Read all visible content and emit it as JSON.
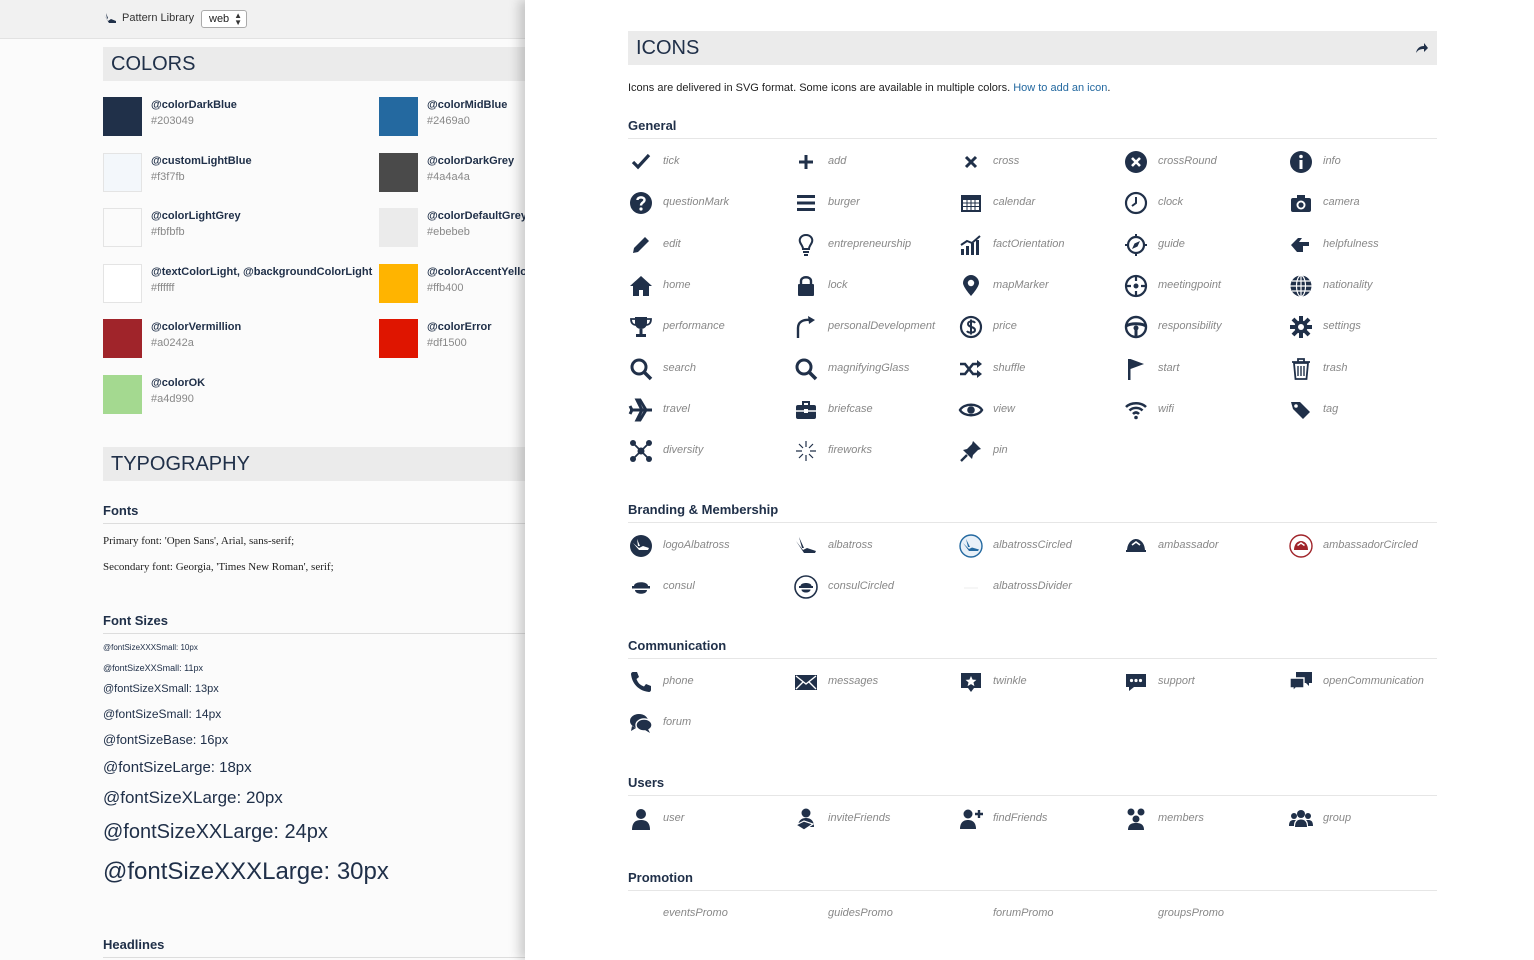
{
  "topbar": {
    "title": "Pattern Library",
    "select_value": "web"
  },
  "colors": {
    "heading": "COLORS",
    "items": [
      {
        "name": "@colorDarkBlue",
        "hex": "#203049"
      },
      {
        "name": "@colorMidBlue",
        "hex": "#2469a0"
      },
      {
        "name": "@customLightBlue",
        "hex": "#f3f7fb"
      },
      {
        "name": "@colorDarkGrey",
        "hex": "#4a4a4a"
      },
      {
        "name": "@colorLightGrey",
        "hex": "#fbfbfb"
      },
      {
        "name": "@colorDefaultGrey",
        "hex": "#ebebeb"
      },
      {
        "name": "@textColorLight, @backgroundColorLight",
        "hex": "#ffffff"
      },
      {
        "name": "@colorAccentYellow",
        "hex": "#ffb400"
      },
      {
        "name": "@colorVermillion",
        "hex": "#a0242a"
      },
      {
        "name": "@colorError",
        "hex": "#df1500"
      },
      {
        "name": "@colorOK",
        "hex": "#a4d990"
      }
    ]
  },
  "typography": {
    "heading": "TYPOGRAPHY",
    "fonts_title": "Fonts",
    "primary": "Primary font: 'Open Sans', Arial, sans-serif;",
    "secondary": "Secondary font: Georgia, 'Times New Roman', serif;",
    "sizes_title": "Font Sizes",
    "sizes": [
      "@fontSizeXXXSmall: 10px",
      "@fontSizeXXSmall: 11px",
      "@fontSizeXSmall: 13px",
      "@fontSizeSmall: 14px",
      "@fontSizeBase: 16px",
      "@fontSizeLarge: 18px",
      "@fontSizeXLarge: 20px",
      "@fontSizeXXLarge: 24px",
      "@fontSizeXXXLarge: 30px"
    ],
    "headlines_title": "Headlines"
  },
  "icons": {
    "heading": "ICONS",
    "intro_text": "Icons are delivered in SVG format. Some icons are available in multiple colors. ",
    "intro_link": "How to add an icon",
    "intro_end": ".",
    "sections": [
      {
        "title": "General",
        "items": [
          {
            "label": "tick",
            "icon": "tick-icon"
          },
          {
            "label": "add",
            "icon": "add-icon"
          },
          {
            "label": "cross",
            "icon": "cross-icon"
          },
          {
            "label": "crossRound",
            "icon": "cross-round-icon"
          },
          {
            "label": "info",
            "icon": "info-icon"
          },
          {
            "label": "questionMark",
            "icon": "question-mark-icon"
          },
          {
            "label": "burger",
            "icon": "burger-icon"
          },
          {
            "label": "calendar",
            "icon": "calendar-icon"
          },
          {
            "label": "clock",
            "icon": "clock-icon"
          },
          {
            "label": "camera",
            "icon": "camera-icon"
          },
          {
            "label": "edit",
            "icon": "edit-icon"
          },
          {
            "label": "entrepreneurship",
            "icon": "lightbulb-icon"
          },
          {
            "label": "factOrientation",
            "icon": "chart-icon"
          },
          {
            "label": "guide",
            "icon": "compass-icon"
          },
          {
            "label": "helpfulness",
            "icon": "hand-icon"
          },
          {
            "label": "home",
            "icon": "home-icon"
          },
          {
            "label": "lock",
            "icon": "lock-icon"
          },
          {
            "label": "mapMarker",
            "icon": "map-marker-icon"
          },
          {
            "label": "meetingpoint",
            "icon": "meetingpoint-icon"
          },
          {
            "label": "nationality",
            "icon": "globe-icon"
          },
          {
            "label": "performance",
            "icon": "trophy-icon"
          },
          {
            "label": "personalDevelopment",
            "icon": "growth-icon"
          },
          {
            "label": "price",
            "icon": "dollar-icon"
          },
          {
            "label": "responsibility",
            "icon": "steering-wheel-icon"
          },
          {
            "label": "settings",
            "icon": "gear-icon"
          },
          {
            "label": "search",
            "icon": "search-icon"
          },
          {
            "label": "magnifyingGlass",
            "icon": "magnifying-glass-icon"
          },
          {
            "label": "shuffle",
            "icon": "shuffle-icon"
          },
          {
            "label": "start",
            "icon": "flag-icon"
          },
          {
            "label": "trash",
            "icon": "trash-icon"
          },
          {
            "label": "travel",
            "icon": "airplane-icon"
          },
          {
            "label": "briefcase",
            "icon": "briefcase-icon"
          },
          {
            "label": "view",
            "icon": "eye-icon"
          },
          {
            "label": "wifi",
            "icon": "wifi-icon"
          },
          {
            "label": "tag",
            "icon": "tag-icon"
          },
          {
            "label": "diversity",
            "icon": "diversity-icon"
          },
          {
            "label": "fireworks",
            "icon": "fireworks-icon"
          },
          {
            "label": "pin",
            "icon": "pin-icon"
          }
        ]
      },
      {
        "title": "Branding & Membership",
        "items": [
          {
            "label": "logoAlbatross",
            "icon": "logo-albatross-icon"
          },
          {
            "label": "albatross",
            "icon": "albatross-icon"
          },
          {
            "label": "albatrossCircled",
            "icon": "albatross-circled-icon"
          },
          {
            "label": "ambassador",
            "icon": "ambassador-icon"
          },
          {
            "label": "ambassadorCircled",
            "icon": "ambassador-circled-icon"
          },
          {
            "label": "consul",
            "icon": "consul-icon"
          },
          {
            "label": "consulCircled",
            "icon": "consul-circled-icon"
          },
          {
            "label": "albatrossDivider",
            "icon": "albatross-divider-icon"
          }
        ]
      },
      {
        "title": "Communication",
        "items": [
          {
            "label": "phone",
            "icon": "phone-icon"
          },
          {
            "label": "messages",
            "icon": "envelope-icon"
          },
          {
            "label": "twinkle",
            "icon": "star-bubble-icon"
          },
          {
            "label": "support",
            "icon": "chat-bubble-icon"
          },
          {
            "label": "openCommunication",
            "icon": "chat-bubbles-icon"
          },
          {
            "label": "forum",
            "icon": "forum-icon"
          }
        ]
      },
      {
        "title": "Users",
        "items": [
          {
            "label": "user",
            "icon": "user-icon"
          },
          {
            "label": "inviteFriends",
            "icon": "invite-friends-icon"
          },
          {
            "label": "findFriends",
            "icon": "find-friends-icon"
          },
          {
            "label": "members",
            "icon": "members-icon"
          },
          {
            "label": "group",
            "icon": "group-icon"
          }
        ]
      },
      {
        "title": "Promotion",
        "items": [
          {
            "label": "eventsPromo",
            "icon": "events-promo-icon"
          },
          {
            "label": "guidesPromo",
            "icon": "guides-promo-icon"
          },
          {
            "label": "forumPromo",
            "icon": "forum-promo-icon"
          },
          {
            "label": "groupsPromo",
            "icon": "groups-promo-icon"
          }
        ]
      }
    ]
  }
}
